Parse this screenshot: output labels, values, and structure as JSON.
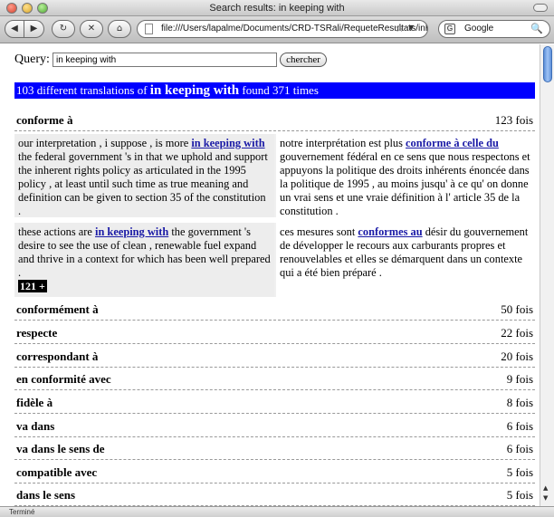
{
  "window": {
    "title": "Search results: in keeping with"
  },
  "toolbar": {
    "back_icon": "◀",
    "forward_icon": "▶",
    "reload_icon": "↻",
    "stop_icon": "✕",
    "home_icon": "⌂",
    "url": "file:///Users/lapalme/Documents/CRD-TSRali/RequeteResultats/inK",
    "bookmark_icon": "☆",
    "dropdown_icon": "▼",
    "search_engine_icon": "G",
    "search_value": "Google",
    "search_icon": "🔍"
  },
  "query": {
    "label": "Query:",
    "value": "in keeping with",
    "submit_label": "chercher"
  },
  "banner": {
    "prefix": "103 different translations of",
    "term": "in keeping with",
    "suffix": "found 371 times"
  },
  "first_row": {
    "term": "conforme à",
    "count": "123 fois"
  },
  "examples": [
    {
      "en_before": "our interpretation , i suppose , is more",
      "en_match": "in keeping with",
      "en_after": "the federal government 's in that we uphold and support the inherent rights policy as articulated in the 1995 policy , at least until such time as true meaning and definition can be given to section 35 of the constitution .",
      "fr_before": "notre interprétation est plus",
      "fr_match": "conforme à celle du",
      "fr_after": "gouvernement fédéral en ce sens que nous respectons et appuyons la politique des droits inhérents énoncée dans la politique de 1995 , au moins jusqu' à ce qu' on donne un vrai sens et une vraie définition à l' article 35 de la constitution ."
    },
    {
      "en_before": "these actions are",
      "en_match": "in keeping with",
      "en_after": "the government 's desire to see the use of clean , renewable fuel expand and thrive in a context for which has been well prepared .",
      "more_label": "121 +",
      "fr_before": "ces mesures sont",
      "fr_match": "conformes au",
      "fr_after": "désir du gouvernement de développer le recours aux carburants propres et renouvelables et elles se démarquent dans un contexte qui a été bien préparé ."
    }
  ],
  "rows": [
    {
      "term": "conformément à",
      "count": "50 fois"
    },
    {
      "term": "respecte",
      "count": "22 fois"
    },
    {
      "term": "correspondant à",
      "count": "20 fois"
    },
    {
      "term": "en conformité avec",
      "count": "9 fois"
    },
    {
      "term": "fidèle à",
      "count": "8 fois"
    },
    {
      "term": "va dans",
      "count": "6 fois"
    },
    {
      "term": "va dans le sens de",
      "count": "6 fois"
    },
    {
      "term": "compatible avec",
      "count": "5 fois"
    },
    {
      "term": "dans le sens",
      "count": "5 fois"
    }
  ],
  "status": {
    "text": "Terminé"
  }
}
